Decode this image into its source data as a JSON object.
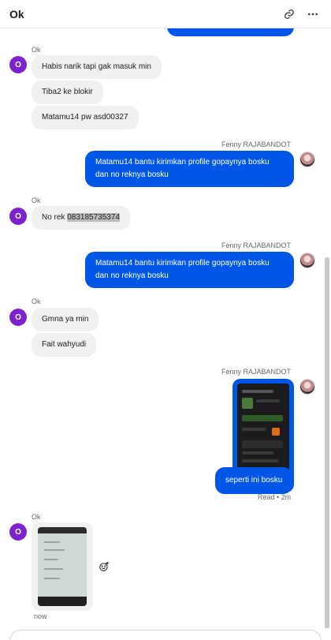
{
  "header": {
    "title": "Ok",
    "link_icon": "link-icon",
    "more_icon": "more-dots-icon"
  },
  "thread": {
    "contact_name": "Ok",
    "contact_initial": "O",
    "my_name": "Fenny RAJABANDOT",
    "group1": {
      "sender": "Ok",
      "messages": [
        "Habis narik tapi gak masuk min",
        "Tiba2 ke blokir",
        "Matamu14 pw asd00327"
      ]
    },
    "out1": {
      "sender": "Fenny RAJABANDOT",
      "text": "Matamu14 bantu kirimkan profile gopaynya bosku dan no reknya bosku"
    },
    "group2": {
      "sender": "Ok",
      "prefix": "No rek ",
      "number": "083185735374"
    },
    "out2": {
      "sender": "Fenny RAJABANDOT",
      "text": "Matamu14 bantu kirimkan profile gopaynya bosku dan no reknya bosku"
    },
    "group3": {
      "sender": "Ok",
      "messages": [
        "Gmna ya min",
        "Fait wahyudi"
      ]
    },
    "out3": {
      "sender": "Fenny RAJABANDOT",
      "text": "seperti ini bosku",
      "status": "Read • 2m"
    },
    "group4": {
      "sender": "Ok",
      "time": "now",
      "react_icon": "emoji-add-icon"
    }
  },
  "composer": {
    "placeholder": ""
  }
}
